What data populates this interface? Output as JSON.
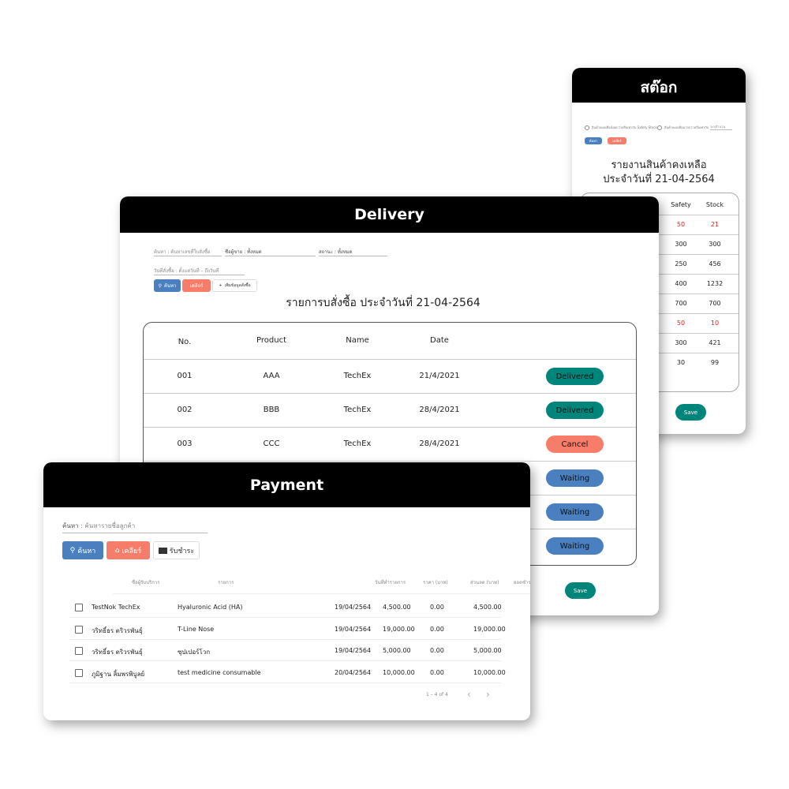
{
  "stock": {
    "title": "สต๊อก",
    "radio1": "สินค้าคงเหลือน้อยกว่าหรือเท่ากับ Safety Stock",
    "radio2": "สินค้าคงเหลือมากกว่าหรือเท่ากับ",
    "radio2_placeholder": "ระบุจำนวน",
    "search": "ค้นหา",
    "clear": "เคลียร์",
    "report_title": "รายงานสินค้าคงเหลือ",
    "report_date": "ประจำวันที่ 21-04-2564",
    "columns": [
      "Safety",
      "Stock"
    ],
    "rows": [
      {
        "safety": "50",
        "stock": "21",
        "low": true
      },
      {
        "safety": "300",
        "stock": "300",
        "low": false
      },
      {
        "safety": "250",
        "stock": "456",
        "low": false
      },
      {
        "safety": "400",
        "stock": "1232",
        "low": false
      },
      {
        "safety": "700",
        "stock": "700",
        "low": false
      },
      {
        "safety": "50",
        "stock": "10",
        "low": true
      },
      {
        "safety": "300",
        "stock": "421",
        "low": false
      },
      {
        "safety": "30",
        "stock": "99",
        "low": false
      }
    ],
    "save": "Save",
    "low_color": "#e02020"
  },
  "delivery": {
    "title": "Delivery",
    "search_field": "ค้นหา : ค้นหาเลขที่ใบสั่งซื้อ",
    "seller_field": "ชื่อผู้ขาย : ทั้งหมด",
    "status_field": "สถานะ : ทั้งหมด",
    "date_field": "วันที่สั่งซื้อ : ตั้งแต่วันที่ – ถึงวันที่",
    "search": "ค้นหา",
    "clear": "เคลียร์",
    "add": "เพิ่มข้อมูลสั่งซื้อ",
    "list_title": "รายการบสั่งซื้อ ประจำวันที่ 21-04-2564",
    "columns": [
      "No.",
      "Product",
      "Name",
      "Date"
    ],
    "rows": [
      {
        "no": "001",
        "product": "AAA",
        "name": "TechEx",
        "date": "21/4/2021",
        "status": "Delivered"
      },
      {
        "no": "002",
        "product": "BBB",
        "name": "TechEx",
        "date": "28/4/2021",
        "status": "Delivered"
      },
      {
        "no": "003",
        "product": "CCC",
        "name": "TechEx",
        "date": "28/4/2021",
        "status": "Cancel"
      },
      {
        "status": "Waiting"
      },
      {
        "status": "Waiting"
      },
      {
        "status": "Waiting"
      }
    ],
    "save": "Save",
    "status_colors": {
      "Delivered": "#00857a",
      "Cancel": "#f77d6b",
      "Waiting": "#4a80bf"
    }
  },
  "payment": {
    "title": "Payment",
    "search_label": "ค้นหา",
    "search_placeholder": "ค้นหารายชื่อลูกค้า",
    "search": "ค้นหา",
    "clear": "เคลียร์",
    "pay": "รับชำระ",
    "columns": [
      "ชื่อผู้รับบริการ",
      "รายการ",
      "วันที่ทำรายการ",
      "ราคา (บาท)",
      "ส่วนลด (บาท)",
      "ยอดชำระ (บาท)"
    ],
    "rows": [
      [
        "TestNok TechEx",
        "Hyaluronic Acid (HA)",
        "19/04/2564",
        "4,500.00",
        "0.00",
        "4,500.00"
      ],
      [
        "วริทธิ์ธร ตริวรพันธุ์",
        "T-Line Nose",
        "19/04/2564",
        "19,000.00",
        "0.00",
        "19,000.00"
      ],
      [
        "วริทธิ์ธร ตริวรพันธุ์",
        "ซุปเปอร์โวก",
        "19/04/2564",
        "5,000.00",
        "0.00",
        "5,000.00"
      ],
      [
        "ภูมิฐาน ลิ้มพรพิบูลย์",
        "test medicine consumable",
        "20/04/2564",
        "10,000.00",
        "0.00",
        "10,000.00"
      ]
    ],
    "pagination": "1 – 4 of 4"
  }
}
